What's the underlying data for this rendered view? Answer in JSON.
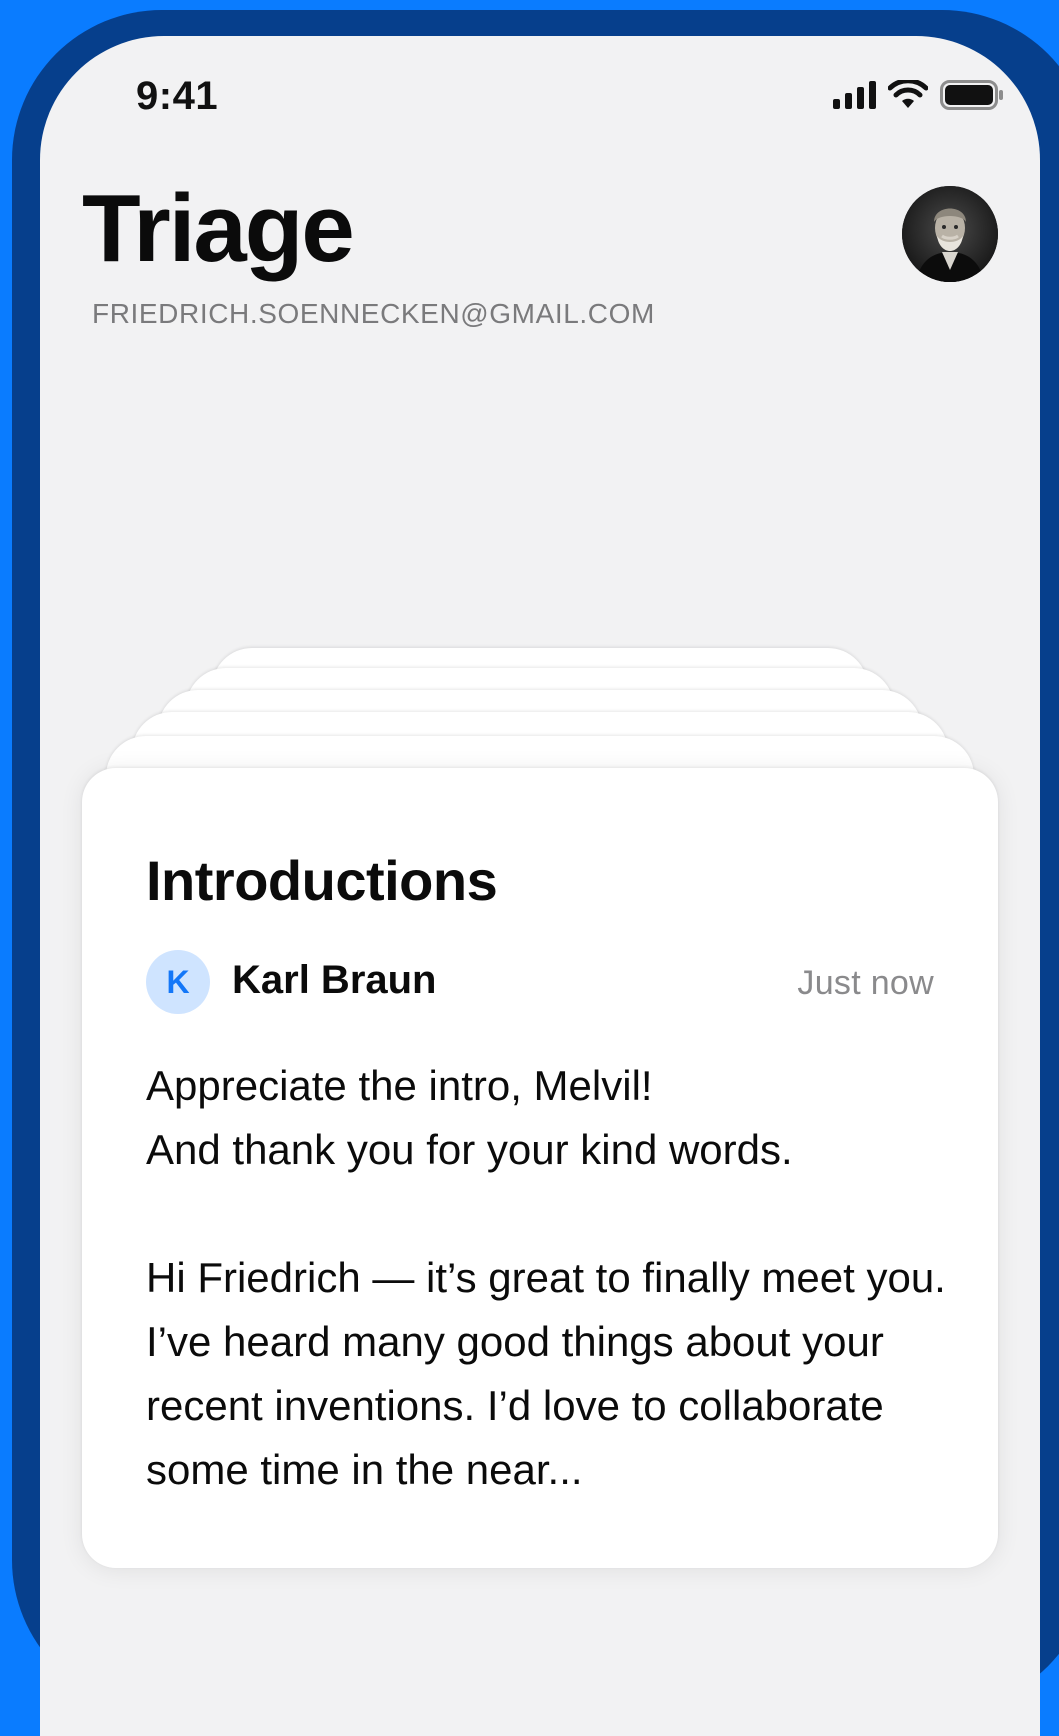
{
  "status_bar": {
    "time": "9:41",
    "icons": [
      "cellular-signal-icon",
      "wifi-icon",
      "battery-icon"
    ]
  },
  "header": {
    "title": "Triage",
    "email": "FRIEDRICH.SOENNECKEN@GMAIL.COM",
    "avatar": "profile-photo"
  },
  "card": {
    "title": "Introductions",
    "sender_initial": "K",
    "sender_name": "Karl Braun",
    "timestamp": "Just now",
    "message_lines": [
      "Appreciate the intro, Melvil!",
      "And thank you for your kind words."
    ],
    "message_body": "Hi Friedrich — it’s great to finally meet you. I’ve heard many good things about your recent inventions. I’d love to collaborate some time in the near..."
  },
  "colors": {
    "background": "#0a7cff",
    "frame": "#063f8c",
    "screen": "#f2f2f3",
    "accent": "#1477f8",
    "accent_light": "#cfe4ff"
  }
}
